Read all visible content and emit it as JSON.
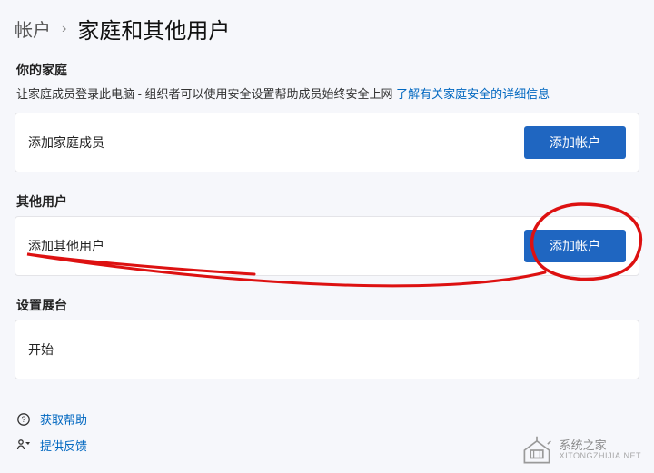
{
  "breadcrumb": {
    "parent": "帐户",
    "separator": "›",
    "current": "家庭和其他用户"
  },
  "family": {
    "title": "你的家庭",
    "desc_prefix": "让家庭成员登录此电脑 - 组织者可以使用安全设置帮助成员始终安全上网 ",
    "link": "了解有关家庭安全的详细信息",
    "card_label": "添加家庭成员",
    "button": "添加帐户"
  },
  "other": {
    "title": "其他用户",
    "card_label": "添加其他用户",
    "button": "添加帐户"
  },
  "kiosk": {
    "title": "设置展台",
    "card_label": "开始"
  },
  "help": {
    "get_help": "获取帮助",
    "feedback": "提供反馈"
  },
  "watermark": {
    "name": "系统之家",
    "sub": "XITONGZHIJIA.NET"
  }
}
